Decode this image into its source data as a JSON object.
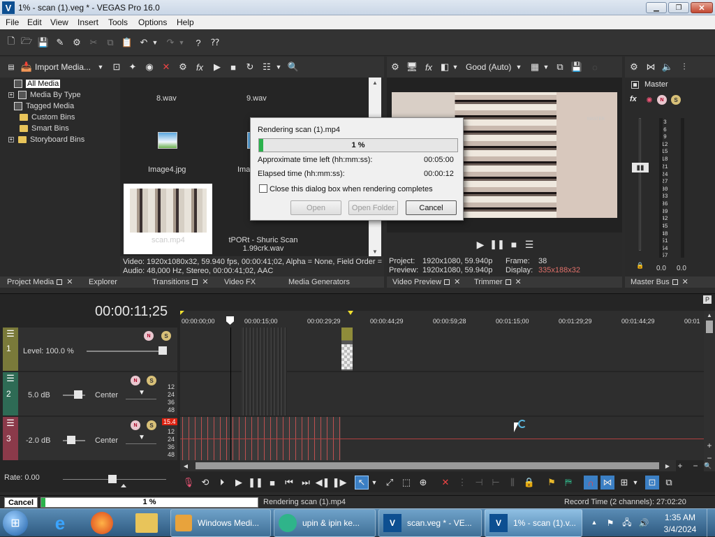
{
  "window": {
    "title": "1% - scan (1).veg * - VEGAS Pro 16.0",
    "app_icon_letter": "V"
  },
  "menu": [
    "File",
    "Edit",
    "View",
    "Insert",
    "Tools",
    "Options",
    "Help"
  ],
  "media_panel": {
    "import_label": "Import Media...",
    "tree": [
      "All Media",
      "Media By Type",
      "Tagged Media",
      "Custom Bins",
      "Smart Bins",
      "Storyboard Bins"
    ],
    "files": {
      "f1": "8.wav",
      "f2": "9.wav",
      "f3": "Image4.jpg",
      "f4": "Ima",
      "f5": "scan.mp4",
      "f6_line1": "tPORt - Shuric Scan",
      "f6_line2": "1.99crk.wav"
    },
    "info_video": "Video: 1920x1080x32, 59.940 fps, 00:00:41;02, Alpha = None, Field Order =",
    "info_audio": "Audio: 48,000 Hz, Stereo, 00:00:41;02, AAC"
  },
  "panel_tabs": {
    "project_media": "Project Media",
    "explorer": "Explorer",
    "transitions": "Transitions",
    "video_fx": "Video FX",
    "media_generators": "Media Generators",
    "video_preview": "Video Preview",
    "trimmer": "Trimmer",
    "master_bus": "Master Bus"
  },
  "preview": {
    "quality": "Good (Auto)",
    "project_label": "Project:",
    "project_value": "1920x1080, 59.940p",
    "preview_label": "Preview:",
    "preview_value": "1920x1080, 59.940p",
    "frame_label": "Frame:",
    "frame_value": "38",
    "display_label": "Display:",
    "display_value": "335x188x32",
    "watermark": "MASTER",
    "display_color": "#e0706a"
  },
  "master": {
    "label": "Master",
    "ticks": [
      "3",
      "6",
      "9",
      "12",
      "15",
      "18",
      "21",
      "24",
      "27",
      "30",
      "33",
      "36",
      "39",
      "42",
      "45",
      "48",
      "51",
      "54",
      "57"
    ],
    "left_val": "0.0",
    "right_val": "0.0"
  },
  "dialog": {
    "title": "Rendering scan (1).mp4",
    "progress_text": "1 %",
    "progress": 0.01,
    "time_left_label": "Approximate time left (hh:mm:ss):",
    "time_left_value": "00:05:00",
    "elapsed_label": "Elapsed time (hh:mm:ss):",
    "elapsed_value": "00:00:12",
    "close_checkbox": "Close this dialog box when rendering completes",
    "open_btn": "Open",
    "open_folder_btn": "Open Folder",
    "cancel_btn": "Cancel"
  },
  "timeline": {
    "timecode": "00:00:11;25",
    "ruler": [
      "00:00:00;00",
      "00:00:15;00",
      "00:00:29;29",
      "00:00:44;29",
      "00:00:59;28",
      "00:01:15;00",
      "00:01:29;29",
      "00:01:44;29",
      "00:01"
    ],
    "track1": {
      "num": "1",
      "level": "Level: 100.0 %"
    },
    "track2": {
      "num": "2",
      "vol": "5.0 dB",
      "pan": "Center",
      "scale": [
        "12",
        "24",
        "36",
        "48"
      ]
    },
    "track3": {
      "num": "3",
      "vol": "-2.0 dB",
      "pan": "Center",
      "peak": "15.4",
      "scale": [
        "12",
        "24",
        "36",
        "48"
      ]
    },
    "rate": "Rate: 0.00"
  },
  "statusbar": {
    "cancel": "Cancel",
    "progress_text": "1 %",
    "progress": 0.01,
    "message": "Rendering scan (1).mp4",
    "record_time": "Record Time (2 channels): 27:02:20"
  },
  "taskbar": {
    "items": [
      "Windows Medi...",
      "upin & ipin ke...",
      "scan.veg * - VE...",
      "1% - scan (1).v..."
    ],
    "time": "1:35 AM",
    "date": "3/4/2024"
  }
}
